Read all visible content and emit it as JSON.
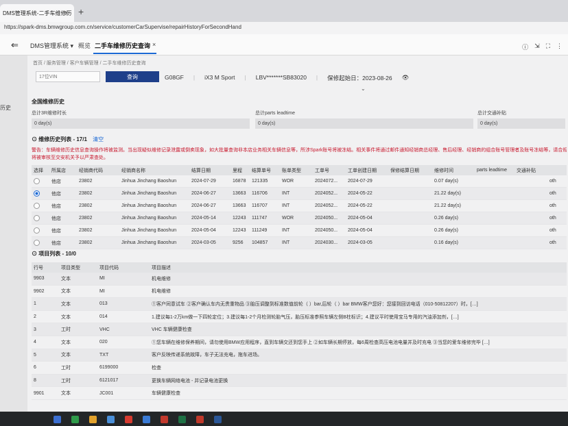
{
  "browser": {
    "tab_title": "DMS管理系统-二手车维修历",
    "tab_close": "×",
    "new_tab": "+",
    "url": "https://spark-dms.bmwgroup.com.cn/service/customerCarSupervise/repairHistoryForSecondHand"
  },
  "header": {
    "menu_icon": "menu-collapse-icon",
    "app_title": "DMS管理系统",
    "chevron": "▾",
    "tabs": [
      {
        "label": "概览"
      },
      {
        "label": "二手车维修历史查询",
        "active": true
      }
    ],
    "close": "×",
    "icons": [
      "info-icon",
      "export-icon",
      "fullscreen-icon",
      "more-icon"
    ]
  },
  "left_nav": {
    "label": "历史"
  },
  "breadcrumb": {
    "text": "首页 / 服务管理 / 客户车辆管理 / 二手车维修历史查询"
  },
  "search": {
    "vin_placeholder": "17位VIN",
    "query_label": "查询"
  },
  "vehicle": {
    "model_code": "G08GF",
    "model_name": "iX3 M Sport",
    "vin_masked": "LBV*******SB83020",
    "warranty_start": "保修起始日：2023-08-26",
    "expand": "⌄"
  },
  "summary": {
    "title": "全国维修历史",
    "stats": [
      {
        "label": "总计3R维修时长",
        "value": "0 day(s)"
      },
      {
        "label": "总计parts leadtime",
        "value": "0 day(s)"
      },
      {
        "label": "总计交通补贴",
        "value": "0 day(s)"
      }
    ]
  },
  "history": {
    "title": "维修历史列表 - 17/1",
    "clear_label": "清空",
    "warning": "警告：车辆维修历史信息查询操作将被监测。当出现疑似维修记录泄露或倒卖现象，如大批量查询非本店业务相关车辆信息等，所涉Spark账号将被冻结。相关事件将通过邮件通知经销商总经理、售后经理、经销商的组合账号管理者及账号冻结等，请合规使用本查询功能。",
    "warning_line2": "将被审核至交安机关予以严肃查处。",
    "columns": [
      "选择",
      "所属店",
      "经销商代码",
      "经销商名称",
      "结算日期",
      "里程",
      "结算单号",
      "账单类型",
      "工单号",
      "工单创建日期",
      "保修结算日期",
      "维修时间",
      "parts leadtime",
      "交通补贴",
      ""
    ],
    "rows": [
      {
        "selected": false,
        "shop": "他店",
        "dealer_code": "23802",
        "dealer_name": "Jinhua Jinchang Baoshun",
        "settle_date": "2024-07-29",
        "mileage": "16878",
        "settle_no": "121335",
        "bill_type": "WOR",
        "wo_no": "2024072...",
        "wo_date": "2024-07-29",
        "warranty_date": "",
        "repair_time": "0.07 day(s)",
        "parts": "",
        "subsidy": "",
        "extra": "oth"
      },
      {
        "selected": true,
        "shop": "他店",
        "dealer_code": "23802",
        "dealer_name": "Jinhua Jinchang Baoshun",
        "settle_date": "2024-06-27",
        "mileage": "13663",
        "settle_no": "116706",
        "bill_type": "INT",
        "wo_no": "2024052...",
        "wo_date": "2024-05-22",
        "warranty_date": "",
        "repair_time": "21.22 day(s)",
        "parts": "",
        "subsidy": "",
        "extra": "oth"
      },
      {
        "selected": false,
        "shop": "他店",
        "dealer_code": "23802",
        "dealer_name": "Jinhua Jinchang Baoshun",
        "settle_date": "2024-06-27",
        "mileage": "13663",
        "settle_no": "116707",
        "bill_type": "INT",
        "wo_no": "2024052...",
        "wo_date": "2024-05-22",
        "warranty_date": "",
        "repair_time": "21.22 day(s)",
        "parts": "",
        "subsidy": "",
        "extra": "oth"
      },
      {
        "selected": false,
        "shop": "他店",
        "dealer_code": "23802",
        "dealer_name": "Jinhua Jinchang Baoshun",
        "settle_date": "2024-05-14",
        "mileage": "12243",
        "settle_no": "111747",
        "bill_type": "WOR",
        "wo_no": "2024050...",
        "wo_date": "2024-05-04",
        "warranty_date": "",
        "repair_time": "0.26 day(s)",
        "parts": "",
        "subsidy": "",
        "extra": "oth"
      },
      {
        "selected": false,
        "shop": "他店",
        "dealer_code": "23802",
        "dealer_name": "Jinhua Jinchang Baoshun",
        "settle_date": "2024-05-04",
        "mileage": "12243",
        "settle_no": "111249",
        "bill_type": "INT",
        "wo_no": "2024050...",
        "wo_date": "2024-05-04",
        "warranty_date": "",
        "repair_time": "0.26 day(s)",
        "parts": "",
        "subsidy": "",
        "extra": "oth"
      },
      {
        "selected": false,
        "shop": "他店",
        "dealer_code": "23802",
        "dealer_name": "Jinhua Jinchang Baoshun",
        "settle_date": "2024-03-05",
        "mileage": "9256",
        "settle_no": "104857",
        "bill_type": "INT",
        "wo_no": "2024030...",
        "wo_date": "2024-03-05",
        "warranty_date": "",
        "repair_time": "0.16 day(s)",
        "parts": "",
        "subsidy": "",
        "extra": "oth"
      }
    ]
  },
  "items": {
    "title": "项目列表 - 10/0",
    "columns": [
      "行号",
      "项目类型",
      "项目代码",
      "项目描述"
    ],
    "rows": [
      {
        "line": "9903",
        "type": "文本",
        "code": "MI",
        "desc": "机电维修"
      },
      {
        "line": "9902",
        "type": "文本",
        "code": "MI",
        "desc": "机电维修"
      },
      {
        "line": "1",
        "type": "文本",
        "code": "013",
        "desc": "①客户同意试车 ②客户确认车内无贵重物品 ③胎压调整到标准数值前轮（ ）bar,后轮（ ）bar BMW客户您好：您接到回访电话（010-50812207）时，[…]"
      },
      {
        "line": "2",
        "type": "文本",
        "code": "014",
        "desc": "1.建议每1-2万km做一下四轮定位；3.建议每1-2个月检测轮胎气压，胎压标准参照车辆左侧B柱标识；4.建议平时使用宝马专用的汽油添加剂，[…]"
      },
      {
        "line": "3",
        "type": "工时",
        "code": "VHC",
        "desc": "VHC 车辆健康检查"
      },
      {
        "line": "4",
        "type": "文本",
        "code": "020",
        "desc": "①您车辆在维修保养期间，请勿使用BMW应用程序，直到车辆交还到您手上 ②如车辆长期停放，每6周检查高压电池电量并及时充电 ③当您的爱车维修完毕 […]"
      },
      {
        "line": "5",
        "type": "文本",
        "code": "TXT",
        "desc": "客户反映传递系统故障，车子无法充电，拖车进场。"
      },
      {
        "line": "6",
        "type": "工时",
        "code": "6199000",
        "desc": "检查"
      },
      {
        "line": "8",
        "type": "工时",
        "code": "6121017",
        "desc": "更换车辆网络电池 - 并记录电池更换"
      },
      {
        "line": "9901",
        "type": "文本",
        "code": "JC001",
        "desc": "车辆健康检查"
      }
    ]
  },
  "colors": {
    "primary": "#1e3f8a",
    "accent": "#1c69d4",
    "warning": "#c8192e"
  }
}
